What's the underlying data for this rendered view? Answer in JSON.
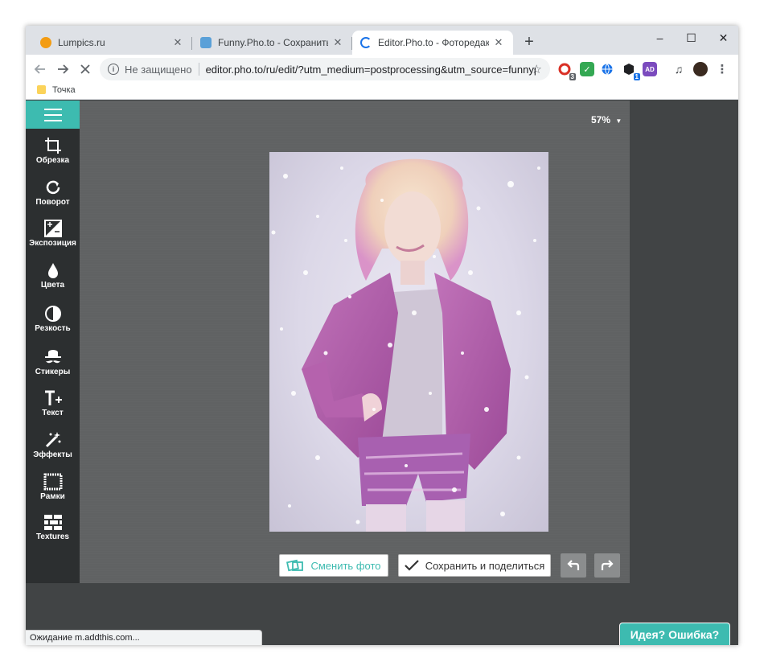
{
  "browser": {
    "tabs": [
      {
        "title": "Lumpics.ru",
        "favicon_color": "#f39c12",
        "active": false
      },
      {
        "title": "Funny.Pho.to - Сохранить, поде",
        "favicon_color": "#5aa0d8",
        "active": false
      },
      {
        "title": "Editor.Pho.to - Фоторедактор он",
        "favicon_color": "#1a73e8",
        "active": true
      }
    ],
    "new_tab": "+",
    "window_controls": {
      "minimize": "–",
      "maximize": "☐",
      "close": "✕"
    },
    "omnibox": {
      "security_label": "Не защищено",
      "url": "editor.pho.to/ru/edit/?utm_medium=postprocessing&utm_source=funnyphot..."
    },
    "extensions": [
      {
        "icon": "adblock-icon",
        "color": "#d93025",
        "badge": "3"
      },
      {
        "icon": "checkmark-icon",
        "color": "#34a853",
        "badge": ""
      },
      {
        "icon": "globe-icon",
        "color": "#1a73e8",
        "badge": ""
      },
      {
        "icon": "cube-icon",
        "color": "#202124",
        "badge": "1"
      },
      {
        "icon": "screen-icon",
        "color": "#7b4bbe",
        "badge": ""
      }
    ],
    "bookmark": "Точка",
    "status": "Ожидание m.addthis.com..."
  },
  "editor": {
    "zoom": "57%",
    "tools": [
      {
        "label": "Обрезка",
        "icon": "crop-icon"
      },
      {
        "label": "Поворот",
        "icon": "rotate-icon"
      },
      {
        "label": "Экспозиция",
        "icon": "exposure-icon"
      },
      {
        "label": "Цвета",
        "icon": "drop-icon"
      },
      {
        "label": "Резкость",
        "icon": "sharpness-icon"
      },
      {
        "label": "Стикеры",
        "icon": "hat-mustache-icon"
      },
      {
        "label": "Текст",
        "icon": "text-plus-icon"
      },
      {
        "label": "Эффекты",
        "icon": "magic-wand-icon"
      },
      {
        "label": "Рамки",
        "icon": "frame-icon"
      },
      {
        "label": "Textures",
        "icon": "bricks-icon"
      }
    ],
    "change_photo_label": "Сменить фото",
    "save_share_label": "Сохранить и поделиться",
    "feedback_label": "Идея? Ошибка?",
    "accent_color": "#3dbbb0"
  }
}
